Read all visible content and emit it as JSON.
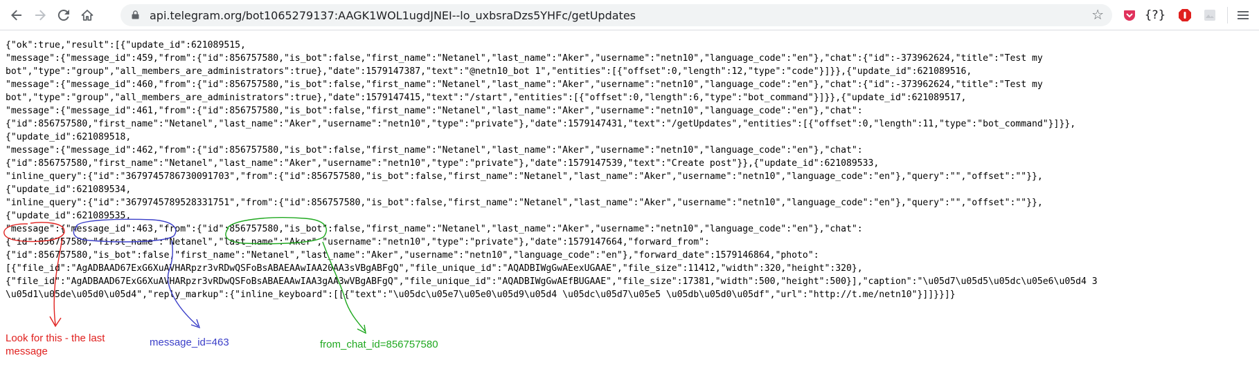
{
  "browser": {
    "url": "api.telegram.org/bot1065279137:AAGK1WOL1ugdJNEI--lo_uxbsraDzs5YHFc/getUpdates",
    "icons": [
      "back-arrow-icon",
      "forward-arrow-icon",
      "reload-icon",
      "home-icon",
      "lock-icon",
      "bookmark-star-icon",
      "extension-icons",
      "menu-icon"
    ],
    "extensions": {
      "question_label": "{?}"
    }
  },
  "response_lines": [
    "{\"ok\":true,\"result\":[{\"update_id\":621089515,",
    "\"message\":{\"message_id\":459,\"from\":{\"id\":856757580,\"is_bot\":false,\"first_name\":\"Netanel\",\"last_name\":\"Aker\",\"username\":\"netn10\",\"language_code\":\"en\"},\"chat\":{\"id\":-373962624,\"title\":\"Test my",
    "bot\",\"type\":\"group\",\"all_members_are_administrators\":true},\"date\":1579147387,\"text\":\"@netn10_bot 1\",\"entities\":[{\"offset\":0,\"length\":12,\"type\":\"code\"}]}},{\"update_id\":621089516,",
    "\"message\":{\"message_id\":460,\"from\":{\"id\":856757580,\"is_bot\":false,\"first_name\":\"Netanel\",\"last_name\":\"Aker\",\"username\":\"netn10\",\"language_code\":\"en\"},\"chat\":{\"id\":-373962624,\"title\":\"Test my",
    "bot\",\"type\":\"group\",\"all_members_are_administrators\":true},\"date\":1579147415,\"text\":\"/start\",\"entities\":[{\"offset\":0,\"length\":6,\"type\":\"bot_command\"}]}},{\"update_id\":621089517,",
    "\"message\":{\"message_id\":461,\"from\":{\"id\":856757580,\"is_bot\":false,\"first_name\":\"Netanel\",\"last_name\":\"Aker\",\"username\":\"netn10\",\"language_code\":\"en\"},\"chat\":",
    "{\"id\":856757580,\"first_name\":\"Netanel\",\"last_name\":\"Aker\",\"username\":\"netn10\",\"type\":\"private\"},\"date\":1579147431,\"text\":\"/getUpdates\",\"entities\":[{\"offset\":0,\"length\":11,\"type\":\"bot_command\"}]}},",
    "{\"update_id\":621089518,",
    "\"message\":{\"message_id\":462,\"from\":{\"id\":856757580,\"is_bot\":false,\"first_name\":\"Netanel\",\"last_name\":\"Aker\",\"username\":\"netn10\",\"language_code\":\"en\"},\"chat\":",
    "{\"id\":856757580,\"first_name\":\"Netanel\",\"last_name\":\"Aker\",\"username\":\"netn10\",\"type\":\"private\"},\"date\":1579147539,\"text\":\"Create post\"}},{\"update_id\":621089533,",
    "\"inline_query\":{\"id\":\"3679745786730091703\",\"from\":{\"id\":856757580,\"is_bot\":false,\"first_name\":\"Netanel\",\"last_name\":\"Aker\",\"username\":\"netn10\",\"language_code\":\"en\"},\"query\":\"\",\"offset\":\"\"}},",
    "{\"update_id\":621089534,",
    "\"inline_query\":{\"id\":\"3679745789528331751\",\"from\":{\"id\":856757580,\"is_bot\":false,\"first_name\":\"Netanel\",\"last_name\":\"Aker\",\"username\":\"netn10\",\"language_code\":\"en\"},\"query\":\"\",\"offset\":\"\"}},",
    "{\"update_id\":621089535,",
    "\"message\":{\"message_id\":463,\"from\":{\"id\":856757580,\"is_bot\":false,\"first_name\":\"Netanel\",\"last_name\":\"Aker\",\"username\":\"netn10\",\"language_code\":\"en\"},\"chat\":",
    "{\"id\":856757580,\"first_name\":\"Netanel\",\"last_name\":\"Aker\",\"username\":\"netn10\",\"type\":\"private\"},\"date\":1579147664,\"forward_from\":",
    "{\"id\":856757580,\"is_bot\":false,\"first_name\":\"Netanel\",\"last_name\":\"Aker\",\"username\":\"netn10\",\"language_code\":\"en\"},\"forward_date\":1579146864,\"photo\":",
    "[{\"file_id\":\"AgADBAAD67ExG6XuAVHARpzr3vRDwQSFoBsABAEAAwIAA20AA3sVBgABFgQ\",\"file_unique_id\":\"AQADBIWgGwAEexUGAAE\",\"file_size\":11412,\"width\":320,\"height\":320},",
    "{\"file_id\":\"AgADBAAD67ExG6XuAVHARpzr3vRDwQSFoBsABAEAAwIAA3gAA3wVBgABFgQ\",\"file_unique_id\":\"AQADBIWgGwAEfBUGAAE\",\"file_size\":17381,\"width\":500,\"height\":500}],\"caption\":\"\\u05d7\\u05d5\\u05dc\\u05e6\\u05d4 3",
    "\\u05d1\\u05de\\u05d0\\u05d4\",\"reply_markup\":{\"inline_keyboard\":[[{\"text\":\"\\u05dc\\u05e7\\u05e0\\u05d9\\u05d4 \\u05dc\\u05d7\\u05e5 \\u05db\\u05d0\\u05df\",\"url\":\"http://t.me/netn10\"}]]}}]}"
  ],
  "annotations": {
    "red": {
      "text": "Look for this - the last\nmessage",
      "color": "#e0201e"
    },
    "blue": {
      "text": "message_id=463",
      "color": "#3a3ec8"
    },
    "green": {
      "text": "from_chat_id=856757580",
      "color": "#1fa81f"
    }
  }
}
